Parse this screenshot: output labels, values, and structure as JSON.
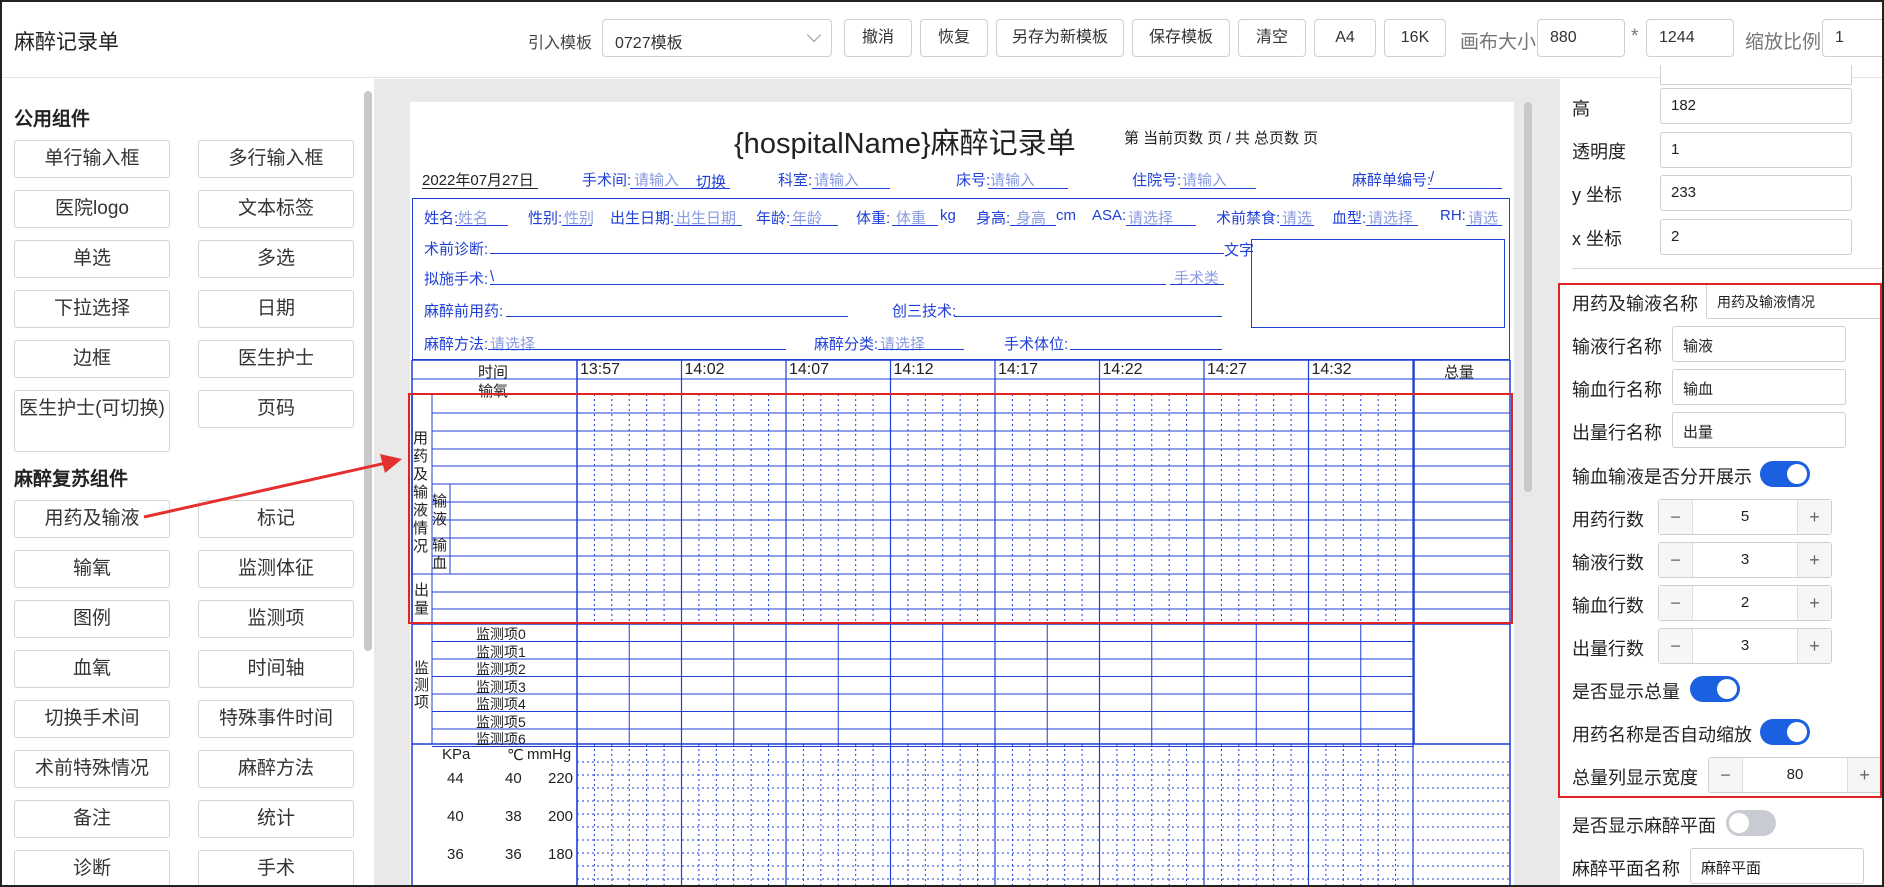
{
  "app": {
    "title": "麻醉记录单"
  },
  "toolbar": {
    "template_label": "引入模板",
    "template_value": "0727模板",
    "buttons": [
      "撤消",
      "恢复",
      "另存为新模板",
      "保存模板",
      "清空",
      "A4",
      "16K"
    ],
    "canvas_size_label": "画布大小",
    "canvas_width": "880",
    "times_sign": "*",
    "canvas_height": "1244",
    "zoom_label": "缩放比例",
    "zoom_value": "1"
  },
  "left_panel": {
    "public_title": "公用组件",
    "public_items": [
      "单行输入框",
      "多行输入框",
      "医院logo",
      "文本标签",
      "单选",
      "多选",
      "下拉选择",
      "日期",
      "边框",
      "医生护士",
      "医生护士(可切换)",
      "页码"
    ],
    "anes_title": "麻醉复苏组件",
    "anes_items": [
      "用药及输液",
      "标记",
      "输氧",
      "监测体征",
      "图例",
      "监测项",
      "血氧",
      "时间轴",
      "切换手术间",
      "特殊事件时间",
      "术前特殊情况",
      "麻醉方法",
      "备注",
      "统计",
      "诊断",
      "手术"
    ]
  },
  "document": {
    "title": "{hospitalName}麻醉记录单",
    "page_info": "第 当前页数 页 / 共 总页数 页",
    "date": "2022年07月27日",
    "row1": [
      {
        "label": "手术间:",
        "value": "请输入",
        "extra": "切换"
      },
      {
        "label": "科室:",
        "value": "请输入"
      },
      {
        "label": "床号:",
        "value": "请输入"
      },
      {
        "label": "住院号:",
        "value": "请输入"
      },
      {
        "label": "麻醉单编号:",
        "value": "/"
      }
    ],
    "patient": [
      {
        "label": "姓名:",
        "value": "姓名"
      },
      {
        "label": "性别:",
        "value": "性别"
      },
      {
        "label": "出生日期:",
        "value": "出生日期"
      },
      {
        "label": "年龄:",
        "value": "年龄"
      },
      {
        "label": "体重:",
        "value": "体重",
        "unit": "kg"
      },
      {
        "label": "身高:",
        "value": "身高",
        "unit": "cm"
      },
      {
        "label": "ASA:",
        "value": "请选择"
      },
      {
        "label": "术前禁食:",
        "value": "请选"
      },
      {
        "label": "血型:",
        "value": "请选择"
      },
      {
        "label": "RH:",
        "value": "请选"
      }
    ],
    "preop_diag": "术前诊断:",
    "text_label": "文字",
    "planned_surgery": "拟施手术:",
    "planned_value": "\\",
    "surgery_type": "手术类",
    "premed": "麻醉前用药:",
    "trauma": "创三技术:",
    "anes_method": "麻醉方法:",
    "anes_method_value": "请选择",
    "anes_class": "麻醉分类:",
    "anes_class_value": "请选择",
    "position": "手术体位:",
    "time_header": "时间",
    "oxygen_label": "输氧",
    "times": [
      "13:57",
      "14:02",
      "14:07",
      "14:12",
      "14:17",
      "14:22",
      "14:27",
      "14:32"
    ],
    "total_header": "总量",
    "drug_group": "用药及输液情况",
    "infusion_label": "输液",
    "blood_label": "输血",
    "output_label": "出量",
    "monitor_group": "监测项",
    "monitor_items": [
      "监测项0",
      "监测项1",
      "监测项2",
      "监测项3",
      "监测项4",
      "监测项5",
      "监测项6"
    ],
    "vitals_headers": [
      "KPa",
      "℃",
      "mmHg"
    ],
    "vitals_rows": [
      [
        "44",
        "40",
        "220"
      ],
      [
        "40",
        "38",
        "200"
      ],
      [
        "36",
        "36",
        "180"
      ]
    ]
  },
  "right_panel": {
    "fields_top": [
      {
        "label": "高",
        "value": "182"
      },
      {
        "label": "透明度",
        "value": "1"
      },
      {
        "label": "y 坐标",
        "value": "233"
      },
      {
        "label": "x 坐标",
        "value": "2"
      }
    ],
    "drug_name_label": "用药及输液名称",
    "drug_name_value": "用药及输液情况",
    "infusion_row_label": "输液行名称",
    "infusion_row_value": "输液",
    "blood_row_label": "输血行名称",
    "blood_row_value": "输血",
    "output_row_label": "出量行名称",
    "output_row_value": "出量",
    "split_label": "输血输液是否分开展示",
    "split_on": true,
    "drug_rows_label": "用药行数",
    "drug_rows": "5",
    "infusion_rows_label": "输液行数",
    "infusion_rows": "3",
    "blood_rows_label": "输血行数",
    "blood_rows": "2",
    "output_rows_label": "出量行数",
    "output_rows": "3",
    "show_total_label": "是否显示总量",
    "show_total_on": true,
    "autoscale_label": "用药名称是否自动缩放",
    "autoscale_on": true,
    "total_width_label": "总量列显示宽度",
    "total_width": "80",
    "show_plane_label": "是否显示麻醉平面",
    "show_plane_on": false,
    "plane_name_label": "麻醉平面名称",
    "plane_name_value": "麻醉平面"
  },
  "colors": {
    "accent": "#1b60e0",
    "doc_blue": "#1f3fd6",
    "highlight": "#e02424"
  }
}
